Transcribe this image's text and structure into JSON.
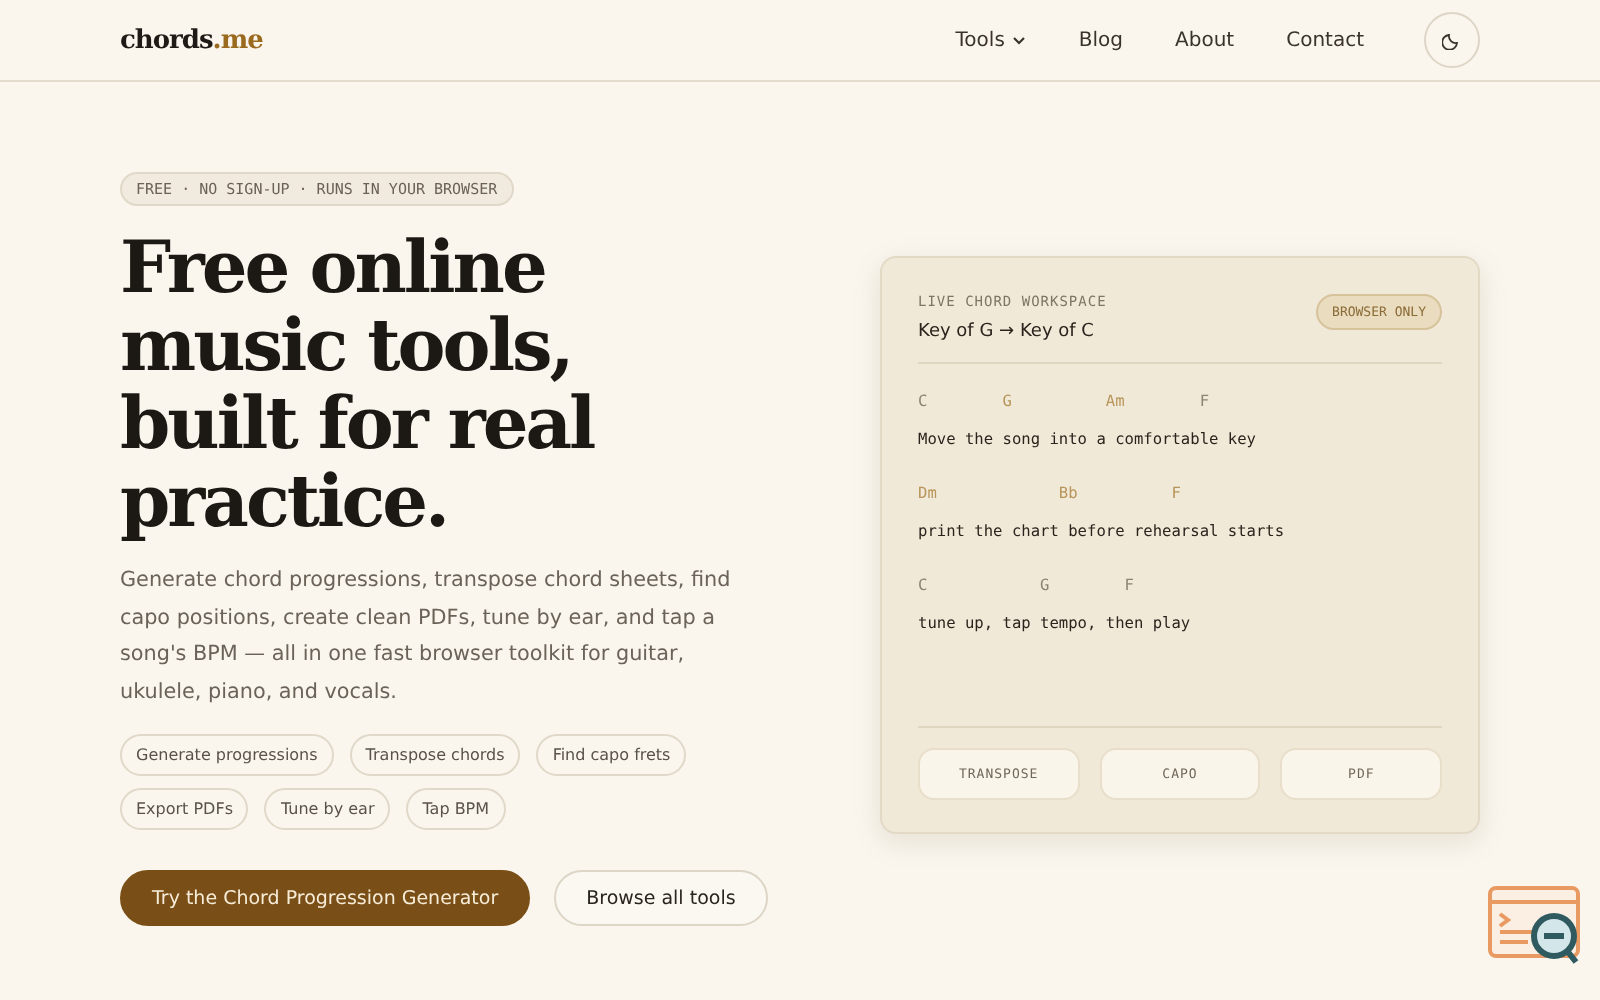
{
  "header": {
    "logo": {
      "main": "chords",
      "accent": ".me"
    },
    "nav": [
      {
        "label": "Tools",
        "dropdown": true
      },
      {
        "label": "Blog",
        "dropdown": false
      },
      {
        "label": "About",
        "dropdown": false
      },
      {
        "label": "Contact",
        "dropdown": false
      }
    ]
  },
  "hero": {
    "eyebrow": "FREE · NO SIGN-UP · RUNS IN YOUR BROWSER",
    "title": "Free online music tools, built for real practice.",
    "description": "Generate chord progressions, transpose chord sheets, find capo positions, create clean PDFs, tune by ear, and tap a song's BPM — all in one fast browser toolkit for guitar, ukulele, piano, and vocals.",
    "features": [
      "Generate progressions",
      "Transpose chords",
      "Find capo frets",
      "Export PDFs",
      "Tune by ear",
      "Tap BPM"
    ],
    "buttons": [
      {
        "label": "Try the Chord Progression Generator",
        "kind": "primary"
      },
      {
        "label": "Browse all tools",
        "kind": "secondary"
      }
    ]
  },
  "workspace": {
    "label": "LIVE CHORD WORKSPACE",
    "key_change": "Key of G → Key of C",
    "badge": "BROWSER ONLY",
    "lines": [
      {
        "chords": [
          {
            "text": "C",
            "highlighted": false
          },
          {
            "text": "G",
            "highlighted": true
          },
          {
            "text": "Am",
            "highlighted": true
          },
          {
            "text": "F",
            "highlighted": false
          }
        ],
        "lyric": "Move the song into a comfortable key"
      },
      {
        "chords": [
          {
            "text": "Dm",
            "highlighted": true
          },
          {
            "text": "Bb",
            "highlighted": true
          },
          {
            "text": "F",
            "highlighted": true
          }
        ],
        "lyric": "print the chart before rehearsal starts"
      },
      {
        "chords": [
          {
            "text": "C",
            "highlighted": false
          },
          {
            "text": "G",
            "highlighted": false
          },
          {
            "text": "F",
            "highlighted": false
          }
        ],
        "lyric": "tune up, tap tempo, then play"
      }
    ],
    "actions": [
      "TRANSPOSE",
      "CAPO",
      "PDF"
    ]
  }
}
